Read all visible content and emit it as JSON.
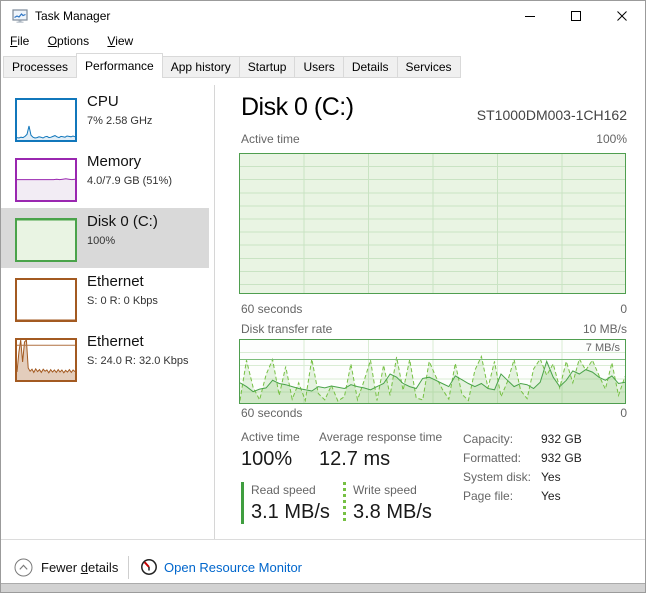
{
  "window": {
    "title": "Task Manager"
  },
  "menu": {
    "items": [
      {
        "key": "F",
        "rest": "ile"
      },
      {
        "key": "O",
        "rest": "ptions"
      },
      {
        "key": "V",
        "rest": "iew"
      }
    ]
  },
  "tabs": {
    "items": [
      "Processes",
      "Performance",
      "App history",
      "Startup",
      "Users",
      "Details",
      "Services"
    ],
    "active": "Performance"
  },
  "sidebar": {
    "items": [
      {
        "title": "CPU",
        "subtitle": "7% 2.58 GHz"
      },
      {
        "title": "Memory",
        "subtitle": "4.0/7.9 GB (51%)"
      },
      {
        "title": "Disk 0 (C:)",
        "subtitle": "100%",
        "selected": true
      },
      {
        "title": "Ethernet",
        "subtitle": "S: 0 R: 0 Kbps"
      },
      {
        "title": "Ethernet",
        "subtitle": "S: 24.0 R: 32.0 Kbps"
      }
    ]
  },
  "main": {
    "title": "Disk 0 (C:)",
    "device": "ST1000DM003-1CH162",
    "active_chart": {
      "label": "Active time",
      "max": "100%",
      "x_left": "60 seconds",
      "x_right": "0"
    },
    "transfer_chart": {
      "label": "Disk transfer rate",
      "max": "10 MB/s",
      "threshold": "7 MB/s",
      "x_left": "60 seconds",
      "x_right": "0"
    },
    "stats": {
      "active_time": {
        "label": "Active time",
        "value": "100%"
      },
      "response": {
        "label": "Average response time",
        "value": "12.7 ms"
      },
      "read": {
        "label": "Read speed",
        "value": "3.1 MB/s"
      },
      "write": {
        "label": "Write speed",
        "value": "3.8 MB/s"
      }
    },
    "details": [
      {
        "label": "Capacity:",
        "value": "932 GB"
      },
      {
        "label": "Formatted:",
        "value": "932 GB"
      },
      {
        "label": "System disk:",
        "value": "Yes"
      },
      {
        "label": "Page file:",
        "value": "Yes"
      }
    ]
  },
  "footer": {
    "fewer": {
      "pre": "Fewer ",
      "key": "d",
      "post": "etails"
    },
    "link": "Open Resource Monitor"
  },
  "colors": {
    "cpu": "#1177bb",
    "memory": "#9a27b0",
    "disk": "#4aa34a",
    "disk_dashed": "#76c043",
    "ethernet": "#a35a21",
    "link": "#0066cc",
    "selected_item": "#d9d9d9",
    "chart_fill": "#e9f4e3"
  },
  "chart_data": {
    "type": "line",
    "transfer_rate": {
      "title": "Disk transfer rate",
      "unit": "MB/s",
      "ylim": [
        0,
        10
      ],
      "threshold_mbs": 7,
      "window_seconds": 60,
      "read_series": [
        3.2,
        2.6,
        1.8,
        2.2,
        2.4,
        3.6,
        3.1,
        2.9,
        2.6,
        2.3,
        2.1,
        1.9,
        2.6,
        2.4,
        2.7,
        2.5,
        2.3,
        2.9,
        2.6,
        2.4,
        2.1,
        2.6,
        3.1,
        4.6,
        4.1,
        3.1,
        2.6,
        2.3,
        3.9,
        4.1,
        3.6,
        3.1,
        2.6,
        4.3,
        3.7,
        3.1,
        2.6,
        3.1,
        2.3,
        2.1,
        4.6,
        3.6,
        2.6,
        3.1,
        2.9,
        2.3,
        3.3,
        6.6,
        4.1,
        2.6,
        3.6,
        5.1,
        4.6,
        5.3,
        4.9,
        4.1,
        3.6,
        4.3,
        3.1,
        3.3
      ],
      "write_series": [
        0.4,
        6.8,
        2.5,
        0.5,
        4.5,
        6.9,
        1.2,
        5.8,
        0.6,
        3.2,
        0.4,
        7.0,
        1.5,
        0.5,
        2.8,
        0.3,
        1.0,
        6.2,
        0.5,
        3.5,
        6.8,
        0.4,
        6.0,
        1.2,
        7.3,
        2.0,
        6.9,
        0.8,
        0.5,
        6.6,
        4.2,
        2.2,
        0.6,
        6.3,
        1.4,
        0.4,
        5.2,
        7.4,
        2.4,
        6.6,
        1.0,
        3.4,
        6.9,
        2.0,
        0.7,
        5.4,
        7.0,
        4.4,
        6.2,
        2.4,
        6.6,
        3.2,
        7.0,
        5.2,
        6.8,
        4.4,
        2.2,
        6.4,
        1.2,
        4.2
      ]
    },
    "active_time": {
      "title": "Active time",
      "ylim": [
        0,
        100
      ],
      "window_seconds": 60,
      "percent_series": [
        100,
        100
      ]
    },
    "sparklines": {
      "cpu": [
        6,
        5,
        7,
        6,
        9,
        14,
        35,
        12,
        7,
        5,
        6,
        8,
        7,
        5,
        8,
        9,
        6,
        7,
        9,
        11,
        8,
        6,
        9,
        8,
        7,
        10,
        9,
        8,
        10,
        8
      ],
      "memory": [
        51,
        51,
        51,
        51,
        51,
        51,
        51,
        51,
        51,
        51,
        51,
        51,
        51,
        52,
        51,
        52,
        53,
        52,
        51,
        52
      ],
      "disk": [
        100,
        100
      ],
      "ethernet_idle": [
        0,
        0
      ],
      "ethernet_active": [
        20,
        70,
        100,
        45,
        95,
        100,
        30,
        22,
        27,
        19,
        28,
        21,
        26,
        19,
        27,
        22,
        25,
        18,
        26,
        20,
        25,
        19,
        26,
        20,
        25,
        18,
        24,
        20,
        26,
        19,
        25,
        21
      ],
      "ethernet_top_line": [
        87,
        87
      ]
    }
  }
}
